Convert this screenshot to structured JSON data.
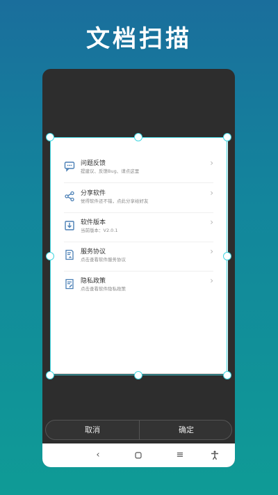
{
  "headline": "文档扫描",
  "document": {
    "items": [
      {
        "title": "问题反馈",
        "subtitle": "提建议、反馈Bug、请点这里",
        "icon": "feedback-icon"
      },
      {
        "title": "分享软件",
        "subtitle": "觉得软件还不错，点此分享给好友",
        "icon": "share-icon"
      },
      {
        "title": "软件版本",
        "subtitle": "当前版本：V2.0.1",
        "icon": "version-icon"
      },
      {
        "title": "服务协议",
        "subtitle": "点击查看软件服务协议",
        "icon": "agreement-icon"
      },
      {
        "title": "隐私政策",
        "subtitle": "点击查看软件隐私政策",
        "icon": "privacy-icon"
      }
    ]
  },
  "actions": {
    "cancel": "取消",
    "confirm": "确定"
  },
  "colors": {
    "accent": "#3fd6e0",
    "icon": "#4a7fb5",
    "phone_bg": "#2d2d2d"
  },
  "navbar": {
    "icons": [
      "back-icon",
      "home-icon",
      "menu-icon",
      "accessibility-icon"
    ]
  }
}
